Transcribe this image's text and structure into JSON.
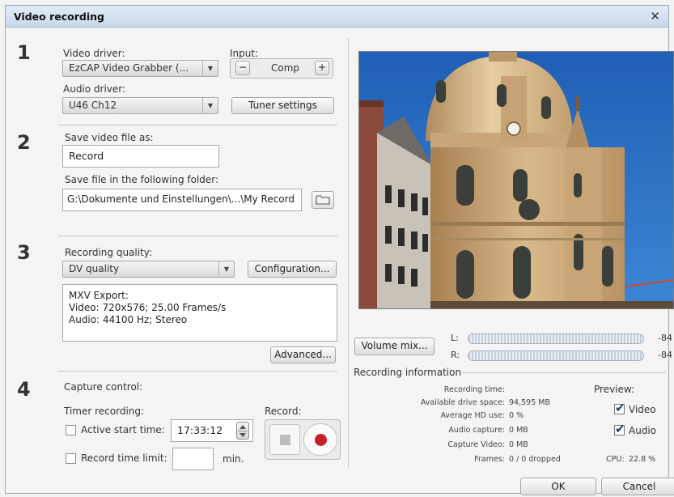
{
  "window": {
    "title": "Video recording"
  },
  "section1": {
    "number": "1",
    "video_driver_label": "Video driver:",
    "video_driver_value": "EzCAP Video Grabber (...",
    "input_label": "Input:",
    "input_value": "Comp",
    "input_minus": "−",
    "input_plus": "+",
    "audio_driver_label": "Audio driver:",
    "audio_driver_value": "U46 Ch12",
    "tuner_button": "Tuner settings"
  },
  "section2": {
    "number": "2",
    "save_as_label": "Save video file as:",
    "save_as_value": "Record",
    "folder_label": "Save file in the following folder:",
    "folder_value": "G:\\Dokumente und Einstellungen\\...\\My Record"
  },
  "section3": {
    "number": "3",
    "quality_label": "Recording quality:",
    "quality_value": "DV quality",
    "configuration_button": "Configuration...",
    "info_lines": [
      "MXV Export:",
      "Video: 720x576; 25.00 Frames/s",
      "Audio: 44100 Hz; Stereo"
    ],
    "advanced_button": "Advanced..."
  },
  "section4": {
    "number": "4",
    "capture_label": "Capture control:",
    "timer_label": "Timer recording:",
    "record_label": "Record:",
    "active_start_label": "Active start time:",
    "active_start_checked": false,
    "start_time_value": "17:33:12",
    "time_limit_label": "Record time limit:",
    "time_limit_checked": false,
    "time_limit_value": "",
    "min_label": "min."
  },
  "audio": {
    "volume_button": "Volume mix...",
    "left_label": "L:",
    "right_label": "R:",
    "left_db": "-84",
    "right_db": "-84"
  },
  "recording_info": {
    "header": "Recording information",
    "rows": [
      {
        "label": "Recording time:",
        "value": ""
      },
      {
        "label": "Available drive space:",
        "value": "94,595 MB"
      },
      {
        "label": "Average HD use:",
        "value": "0 %"
      },
      {
        "label": "Audio capture:",
        "value": "0 MB"
      },
      {
        "label": "Capture Video:",
        "value": "0 MB"
      },
      {
        "label": "Frames:",
        "value": "0 / 0 dropped"
      }
    ],
    "preview_label": "Preview:",
    "video_label": "Video",
    "audio_label": "Audio",
    "video_checked": true,
    "audio_checked": true,
    "cpu_label": "CPU:",
    "cpu_value": "22.8 %"
  },
  "footer": {
    "ok_button": "OK",
    "cancel_button": "Cancel"
  },
  "icons": {
    "close": "close-icon",
    "combo_arrow": "chevron-down-icon",
    "folder": "folder-icon",
    "spinner": "spinner-icon",
    "stop": "stop-icon",
    "record": "record-icon",
    "check": "check-icon"
  },
  "colors": {
    "record_red": "#c8202a",
    "title_gradient_top": "#e1ebf7",
    "sky_blue": "#1f5fb5"
  }
}
